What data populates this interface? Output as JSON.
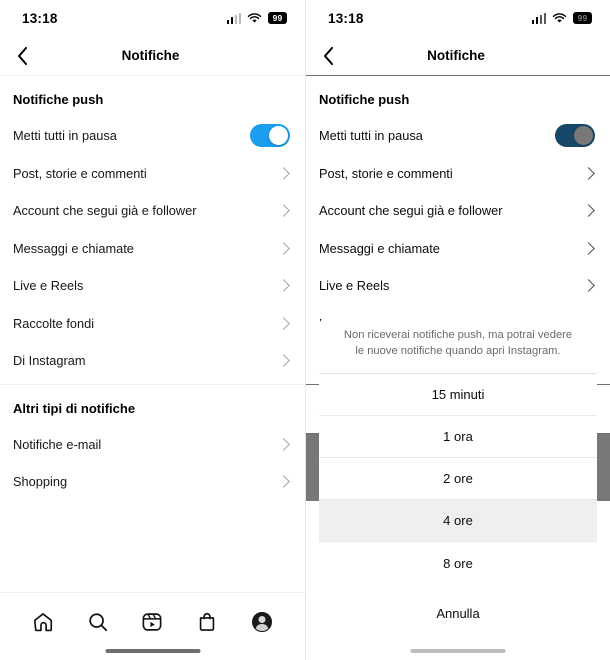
{
  "status_bar": {
    "time": "13:18",
    "battery_level": "99",
    "signal_icon": "cellular-signal-icon",
    "wifi_icon": "wifi-icon"
  },
  "header": {
    "title": "Notifiche",
    "back_icon": "chevron-left-icon"
  },
  "sections": [
    {
      "title": "Notifiche push",
      "rows": [
        {
          "label": "Metti tutti in pausa",
          "control": "toggle",
          "toggle_on": true
        },
        {
          "label": "Post, storie e commenti",
          "control": "chevron"
        },
        {
          "label": "Account che segui già e follower",
          "control": "chevron"
        },
        {
          "label": "Messaggi e chiamate",
          "control": "chevron"
        },
        {
          "label": "Live e Reels",
          "control": "chevron"
        },
        {
          "label": "Raccolte fondi",
          "control": "chevron"
        },
        {
          "label": "Di Instagram",
          "control": "chevron"
        }
      ]
    },
    {
      "title": "Altri tipi di notifiche",
      "rows": [
        {
          "label": "Notifiche e-mail",
          "control": "chevron"
        },
        {
          "label": "Shopping",
          "control": "chevron"
        }
      ]
    }
  ],
  "tab_bar": {
    "items": [
      {
        "icon": "home-icon"
      },
      {
        "icon": "search-icon"
      },
      {
        "icon": "reels-icon"
      },
      {
        "icon": "shop-bag-icon"
      },
      {
        "icon": "profile-avatar-icon"
      }
    ]
  },
  "action_sheet": {
    "message": "Non riceverai notifiche push, ma potrai vedere le nuove notifiche quando apri Instagram.",
    "options": [
      {
        "label": "15 minuti",
        "pressed": false
      },
      {
        "label": "1 ora",
        "pressed": false
      },
      {
        "label": "2 ore",
        "pressed": false
      },
      {
        "label": "4 ore",
        "pressed": true
      },
      {
        "label": "8 ore",
        "pressed": false
      }
    ],
    "cancel_label": "Annulla"
  },
  "colors": {
    "toggle_on": "#1b9df0",
    "text_primary": "#171717",
    "text_muted": "#6b6b6b",
    "divider": "#efefef",
    "pressed_row": "#efefef"
  }
}
